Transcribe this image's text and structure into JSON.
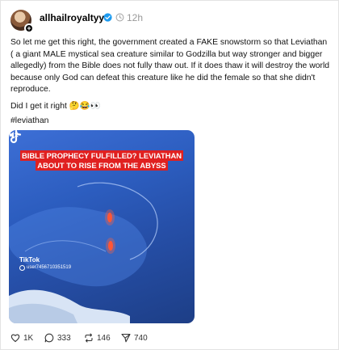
{
  "post": {
    "username": "allhailroyaltyy",
    "time": "12h",
    "body": "So let me get this right, the government created a FAKE snowstorm so that Leviathan ( a giant MALE mystical sea creature similar to Godzilla but way stronger and bigger allegedly) from the Bible does not fully thaw out. If it does thaw it will destroy the world because only God can defeat this creature like he did the female so that she didn't reproduce.",
    "question": "Did I get it right 🤔😂👀",
    "hashtag": "#leviathan"
  },
  "media": {
    "caption": "BIBLE PROPHECY FULFILLED? LEVIATHAN ABOUT TO RISE FROM THE ABYSS",
    "brand": "TikTok",
    "tiktok_user": "user7456710351519"
  },
  "actions": {
    "likes": "1K",
    "replies": "333",
    "reposts": "146",
    "shares": "740"
  },
  "icons": {
    "verified": "verified-badge-icon",
    "clock": "clock-icon",
    "like": "heart-icon",
    "reply": "comment-icon",
    "repost": "repost-icon",
    "share": "share-icon",
    "mute": "muted-speaker-icon"
  },
  "colors": {
    "verified": "#1d9bf0",
    "caption_bg": "#e02020",
    "ocean": "#2c5dbf"
  }
}
